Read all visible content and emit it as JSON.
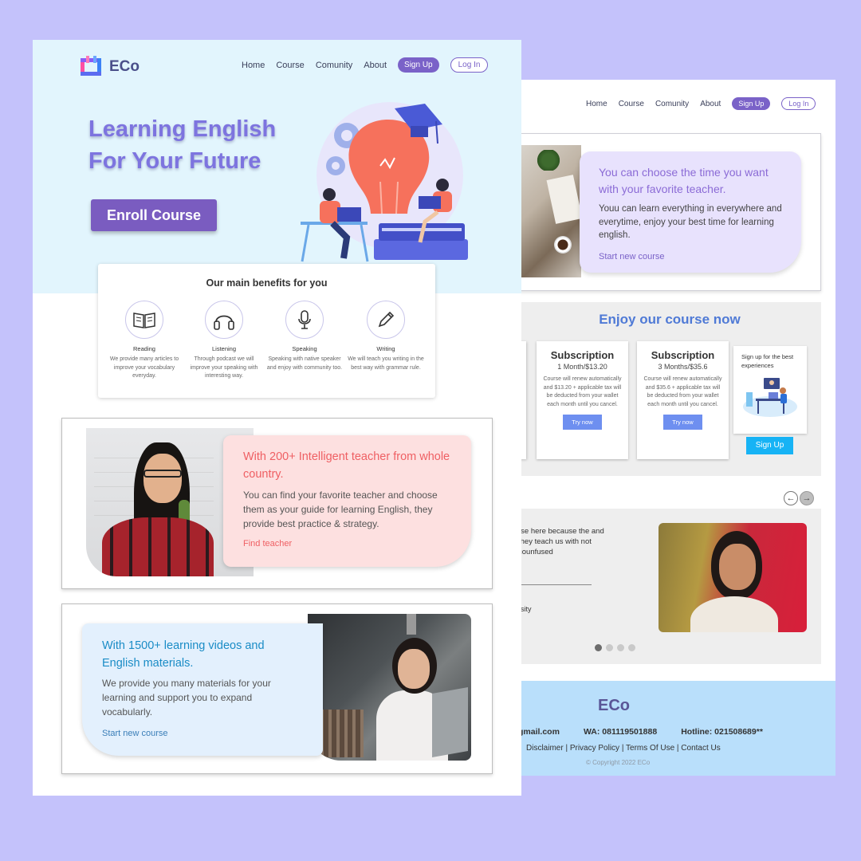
{
  "colors": {
    "background": "#c4c2fb",
    "accent": "#7a62c8",
    "hero_bg": "#e2f5fd",
    "footer_bg": "#b9dffb"
  },
  "front": {
    "brand": "ECo",
    "nav": {
      "items": [
        "Home",
        "Course",
        "Comunity",
        "About"
      ],
      "signup": "Sign Up",
      "login": "Log In"
    },
    "hero": {
      "title_line1": "Learning English",
      "title_line2": "For Your Future",
      "cta": "Enroll Course"
    },
    "benefits": {
      "title": "Our main benefits for you",
      "items": [
        {
          "icon": "book-icon",
          "label": "Reading",
          "desc": "We provide many articles to improve your vocabulary everyday."
        },
        {
          "icon": "headphones-icon",
          "label": "Listening",
          "desc": "Through podcast we will improve your speaking with interesting way."
        },
        {
          "icon": "microphone-icon",
          "label": "Speaking",
          "desc": "Speaking with native speaker and enjoy with community too."
        },
        {
          "icon": "pencil-icon",
          "label": "Writing",
          "desc": "We will teach you writing in the best way with grammar rule."
        }
      ]
    },
    "teacher_card": {
      "title": "With 200+ Intelligent teacher from whole country.",
      "text": "You can find your favorite teacher and choose them as your guide for learning English, they provide best practice & strategy.",
      "link": "Find teacher"
    },
    "videos_card": {
      "title": "With 1500+ learning videos and English materials.",
      "text": "We provide you many materials for your learning and support you to expand vocabularly.",
      "link": "Start new course"
    }
  },
  "back": {
    "nav": {
      "items": [
        "Home",
        "Course",
        "Comunity",
        "About"
      ],
      "signup": "Sign Up",
      "login": "Log In"
    },
    "time_card": {
      "title": "You can choose the time you want with your favorite teacher.",
      "text": "Youu can learn everything in everywhere and everytime, enjoy your best time for learning english.",
      "link": "Start new course"
    },
    "enjoy": {
      "title": "Enjoy our course now",
      "subscriptions": [
        {
          "title": "Subscription",
          "price": "1 Month/$13.20",
          "desc": "Course will renew automatically and $13.20 + applicable tax will be deducted from your wallet each month until you cancel.",
          "button": "Try now"
        },
        {
          "title": "Subscription",
          "price": "3 Months/$35.6",
          "desc": "Course will renew automatically and $35.6 + applicable tax will be deducted from your wallet each month until you cancel.",
          "button": "Try now"
        }
      ],
      "promo_text": "Sign up for the best experiences",
      "promo_button": "Sign Up"
    },
    "testimonial": {
      "quote": "rse here because the and they teach us with not counfused",
      "university": "rsity"
    },
    "footer": {
      "brand": "ECo",
      "email": "gmail.com",
      "wa": "WA: 081119501888",
      "hotline": "Hotline: 021508689**",
      "links": "Disclaimer | Privacy Policy | Terms Of Use | Contact Us",
      "copyright": "© Copyright 2022 ECo"
    }
  }
}
